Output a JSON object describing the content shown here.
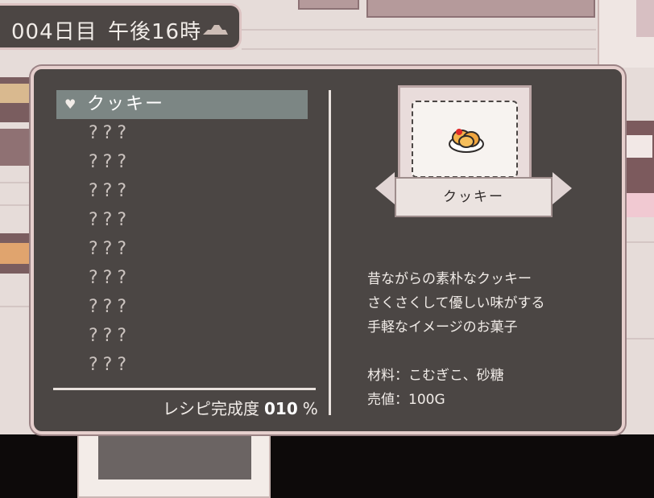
{
  "hud": {
    "day": "004日目",
    "time": "午後16時",
    "weather_icon": "cloudy-icon"
  },
  "recipe_list": {
    "items": [
      {
        "label": "クッキー",
        "selected": true,
        "icon": "heart-icon"
      },
      {
        "label": "???"
      },
      {
        "label": "???"
      },
      {
        "label": "???"
      },
      {
        "label": "???"
      },
      {
        "label": "???"
      },
      {
        "label": "???"
      },
      {
        "label": "???"
      },
      {
        "label": "???"
      },
      {
        "label": "???"
      }
    ],
    "completion_label": "レシピ完成度",
    "completion_value": "010",
    "completion_unit": "%"
  },
  "detail": {
    "name": "クッキー",
    "image_icon": "cookie-icon",
    "description": [
      "昔ながらの素朴なクッキー",
      "さくさくして優しい味がする",
      "手軽なイメージのお菓子"
    ],
    "materials": "材料：こむぎこ、砂糖",
    "price": "売値：100G"
  },
  "colors": {
    "panel_bg": "#4b4644",
    "panel_border": "#e6cfcd",
    "selected_bg": "#7c8684",
    "text": "#f1ece8"
  }
}
